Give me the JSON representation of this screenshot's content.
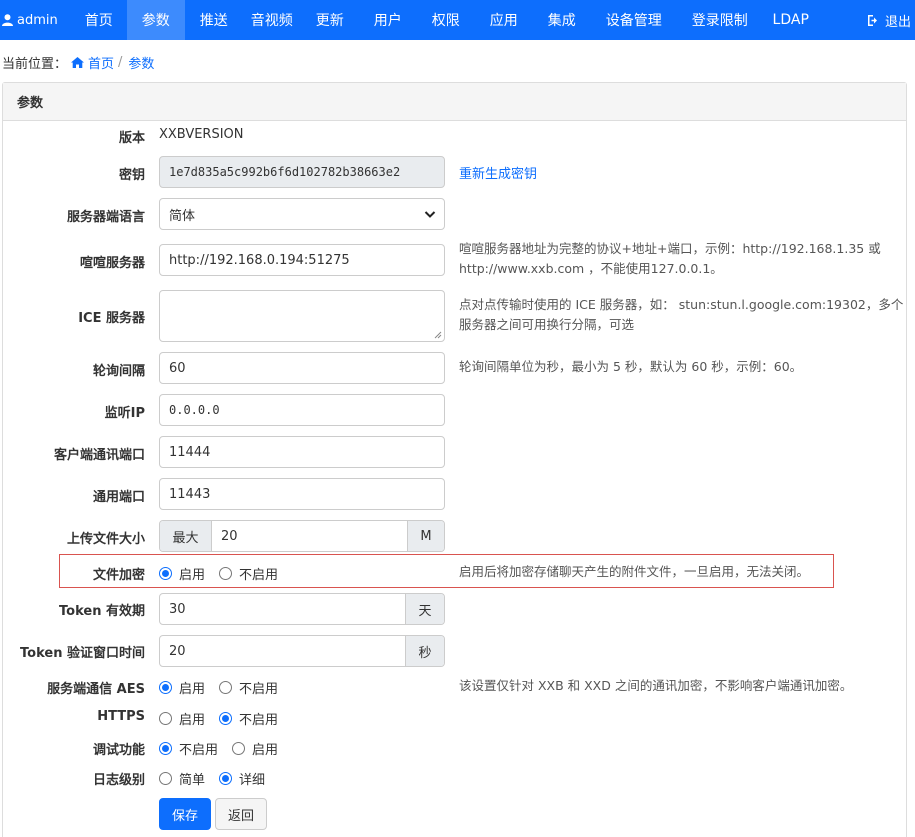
{
  "nav": {
    "user": "admin",
    "items": [
      "首页",
      "参数",
      "推送",
      "音视频",
      "更新",
      "用户",
      "权限",
      "应用",
      "集成",
      "设备管理",
      "登录限制",
      "LDAP"
    ],
    "active_index": 1,
    "logout": "退出",
    "accent": "#0d6efd"
  },
  "breadcrumb": {
    "prefix": "当前位置：",
    "home": "首页",
    "current": "参数"
  },
  "panel": {
    "title": "参数"
  },
  "form": {
    "version": {
      "label": "版本",
      "value": "XXBVERSION"
    },
    "secret": {
      "label": "密钥",
      "value": "1e7d835a5c992b6f6d102782b38663e2",
      "regen": "重新生成密钥"
    },
    "lang": {
      "label": "服务器端语言",
      "value": "简体"
    },
    "xuanxuan": {
      "label": "喧喧服务器",
      "value": "http://192.168.0.194:51275",
      "help1": "喧喧服务器地址为完整的协议+地址+端口，示例：http://192.168.1.35 或",
      "help2": "http://www.xxb.com ，不能使用127.0.0.1。"
    },
    "ice": {
      "label": "ICE 服务器",
      "value": "",
      "help1": "点对点传输时使用的 ICE 服务器，如： stun:stun.l.google.com:19302，多个",
      "help2": "服务器之间可用换行分隔，可选"
    },
    "poll": {
      "label": "轮询间隔",
      "value": "60",
      "help": "轮询间隔单位为秒，最小为 5 秒，默认为 60 秒，示例：60。"
    },
    "ip": {
      "label": "监听IP",
      "value": "0.0.0.0"
    },
    "client_port": {
      "label": "客户端通讯端口",
      "value": "11444"
    },
    "common_port": {
      "label": "通用端口",
      "value": "11443"
    },
    "upload": {
      "label": "上传文件大小",
      "prefix": "最大",
      "value": "20",
      "suffix": "M"
    },
    "encrypt": {
      "label": "文件加密",
      "on": "启用",
      "off": "不启用",
      "selected": "on",
      "help": "启用后将加密存储聊天产生的附件文件，一旦启用，无法关闭。"
    },
    "token": {
      "label": "Token 有效期",
      "value": "30",
      "suffix": "天"
    },
    "token_window": {
      "label": "Token 验证窗口时间",
      "value": "20",
      "suffix": "秒"
    },
    "aes": {
      "label": "服务端通信 AES",
      "on": "启用",
      "off": "不启用",
      "selected": "on",
      "help": "该设置仅针对 XXB 和 XXD 之间的通讯加密，不影响客户端通讯加密。"
    },
    "https": {
      "label": "HTTPS",
      "on": "启用",
      "off": "不启用",
      "selected": "off"
    },
    "debug": {
      "label": "调试功能",
      "off": "不启用",
      "on": "启用",
      "selected": "off"
    },
    "log": {
      "label": "日志级别",
      "simple": "简单",
      "detail": "详细",
      "selected": "detail"
    }
  },
  "buttons": {
    "save": "保存",
    "back": "返回"
  }
}
